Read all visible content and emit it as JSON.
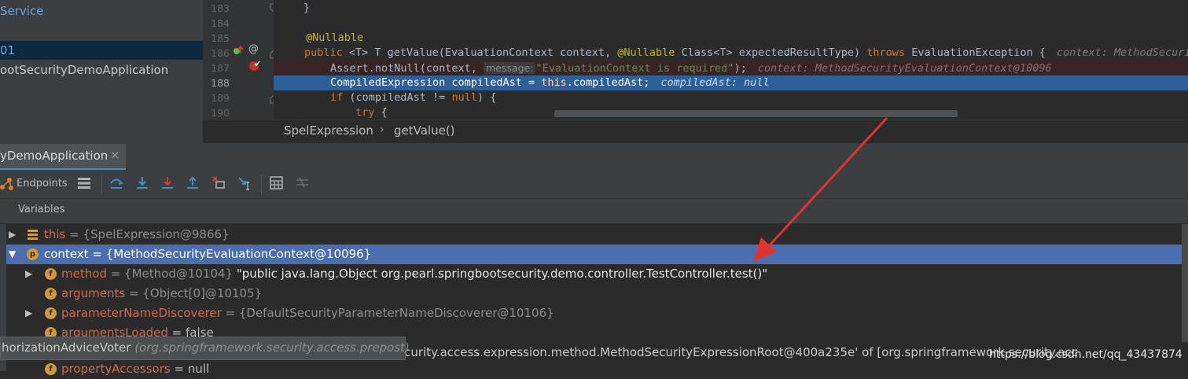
{
  "project_panel": {
    "row1": "Service",
    "row2": "01",
    "row3": "ootSecurityDemoApplication"
  },
  "editor": {
    "line_numbers": [
      "183",
      "184",
      "185",
      "186",
      "187",
      "188",
      "189",
      "190"
    ],
    "current_line": "188",
    "lines": {
      "l183": "}",
      "l185": "@Nullable",
      "l186_kw": "public",
      "l186_a": " <T> T getValue(EvaluationContext context, ",
      "l186_ann": "@Nullable",
      "l186_b": " Class<T> expectedResultType) ",
      "l186_kw2": "throws",
      "l186_c": " EvaluationException {",
      "l186_hint": "context: MethodSecurit",
      "l187_a": "Assert.notNull(context, ",
      "l187_param": "message:",
      "l187_str": "\"EvaluationContext is required\"",
      "l187_b": ");",
      "l187_hint": "context: MethodSecurityEvaluationContext@10096",
      "l188_a": "CompiledExpression compiledAst = ",
      "l188_kw": "this",
      "l188_b": ".compiledAst;",
      "l188_hint": "compiledAst: null",
      "l189_kw": "if",
      "l189_a": " (compiledAst != ",
      "l189_kw2": "null",
      "l189_b": ") {",
      "l190_kw": "try",
      "l190_a": " {"
    }
  },
  "breadcrumb": {
    "class_name": "SpelExpression",
    "separator": "›",
    "method_name": "getValue()"
  },
  "debug_tab": {
    "label": "yDemoApplication",
    "close": "×"
  },
  "toolbar": {
    "endpoints_label": "Endpoints"
  },
  "variables": {
    "title": "Variables",
    "rows": [
      {
        "name": "this",
        "value": " = {SpelExpression@9866}"
      },
      {
        "name": "context",
        "value": " = {MethodSecurityEvaluationContext@10096}"
      },
      {
        "name": "method",
        "value": " = {Method@10104} ",
        "str": "\"public java.lang.Object org.pearl.springbootsecurity.demo.controller.TestController.test()\""
      },
      {
        "name": "arguments",
        "value": " = {Object[0]@10105}"
      },
      {
        "name": "parameterNameDiscoverer",
        "value": " = {DefaultSecurityParameterNameDiscoverer@10106}"
      },
      {
        "name": "argumentsLoaded",
        "value": " = false"
      },
      {
        "name": "propertyAccessors",
        "value": " = null"
      }
    ]
  },
  "tooltip": {
    "class_name": "horizationAdviceVoter",
    "package": "(org.springframework.security.access.prepost)"
  },
  "status_text": "gframework.security.access.expression.method.MethodSecurityExpressionRoot@400a235e' of [org.springframework.security.acc",
  "watermark": "https://blog.csdn.net/qq_43437874",
  "colors": {
    "selection": "#4b6eaf",
    "current_line": "#2d6099",
    "accent_red": "#e0342f"
  }
}
